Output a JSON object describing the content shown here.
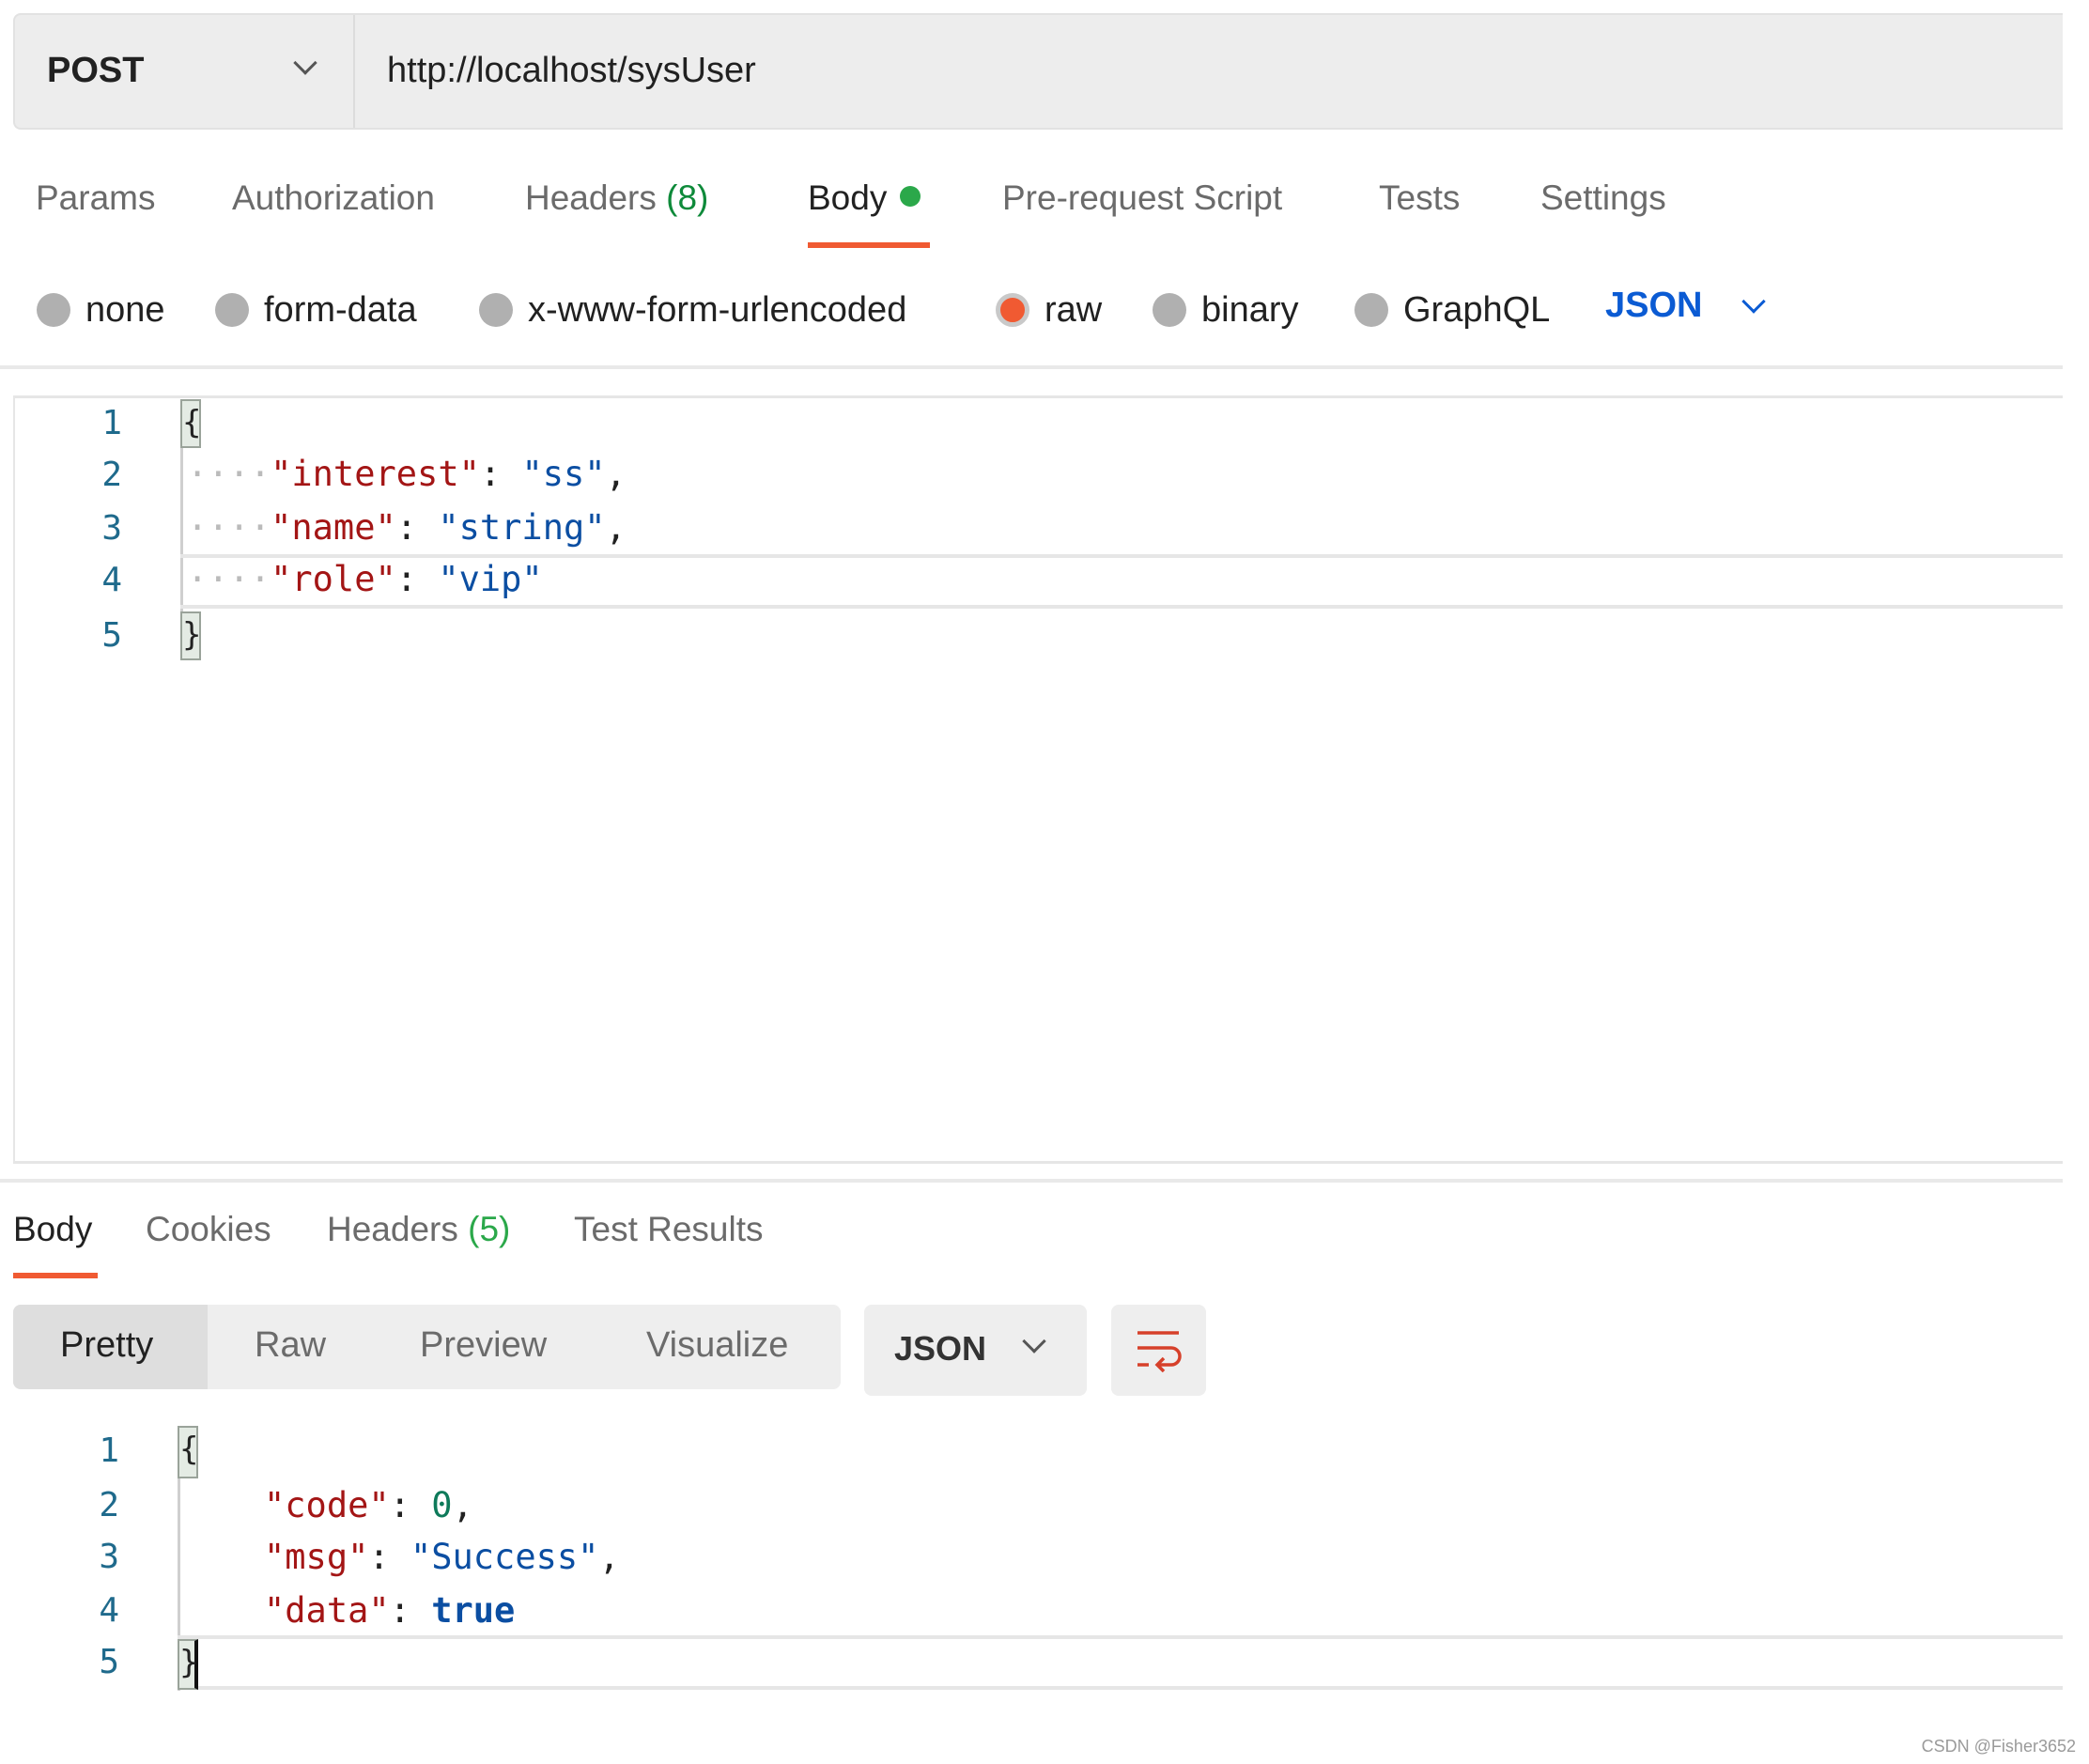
{
  "request": {
    "method": "POST",
    "url": "http://localhost/sysUser"
  },
  "request_tabs": [
    {
      "label": "Params"
    },
    {
      "label": "Authorization"
    },
    {
      "label": "Headers",
      "count": "(8)"
    },
    {
      "label": "Body",
      "active": true,
      "indicator": "green-dot"
    },
    {
      "label": "Pre-request Script"
    },
    {
      "label": "Tests"
    },
    {
      "label": "Settings"
    }
  ],
  "body_types": [
    {
      "label": "none",
      "selected": false
    },
    {
      "label": "form-data",
      "selected": false
    },
    {
      "label": "x-www-form-urlencoded",
      "selected": false
    },
    {
      "label": "raw",
      "selected": true
    },
    {
      "label": "binary",
      "selected": false
    },
    {
      "label": "GraphQL",
      "selected": false
    }
  ],
  "raw_format": "JSON",
  "request_body": {
    "line_numbers": [
      "1",
      "2",
      "3",
      "4",
      "5"
    ],
    "lines": [
      [
        {
          "t": "{",
          "c": "p"
        }
      ],
      [
        {
          "t": "\"interest\"",
          "c": "k"
        },
        {
          "t": ": ",
          "c": "p"
        },
        {
          "t": "\"ss\"",
          "c": "s"
        },
        {
          "t": ",",
          "c": "p"
        }
      ],
      [
        {
          "t": "\"name\"",
          "c": "k"
        },
        {
          "t": ": ",
          "c": "p"
        },
        {
          "t": "\"string\"",
          "c": "s"
        },
        {
          "t": ",",
          "c": "p"
        }
      ],
      [
        {
          "t": "\"role\"",
          "c": "k"
        },
        {
          "t": ": ",
          "c": "p"
        },
        {
          "t": "\"vip\"",
          "c": "s"
        }
      ],
      [
        {
          "t": "}",
          "c": "p"
        }
      ]
    ]
  },
  "response_tabs": [
    {
      "label": "Body",
      "active": true
    },
    {
      "label": "Cookies"
    },
    {
      "label": "Headers",
      "count": "(5)"
    },
    {
      "label": "Test Results"
    }
  ],
  "view_modes": [
    {
      "label": "Pretty",
      "active": true
    },
    {
      "label": "Raw"
    },
    {
      "label": "Preview"
    },
    {
      "label": "Visualize"
    }
  ],
  "response_format": "JSON",
  "response_body": {
    "line_numbers": [
      "1",
      "2",
      "3",
      "4",
      "5"
    ],
    "code_key": "\"code\"",
    "code_val": "0",
    "msg_key": "\"msg\"",
    "msg_val": "\"Success\"",
    "data_key": "\"data\"",
    "data_val": "true"
  },
  "colors": {
    "accent": "#f05a32",
    "json_link": "#0b5bd3",
    "count_green": "#0e8a3a"
  },
  "watermark": "CSDN @Fisher3652"
}
